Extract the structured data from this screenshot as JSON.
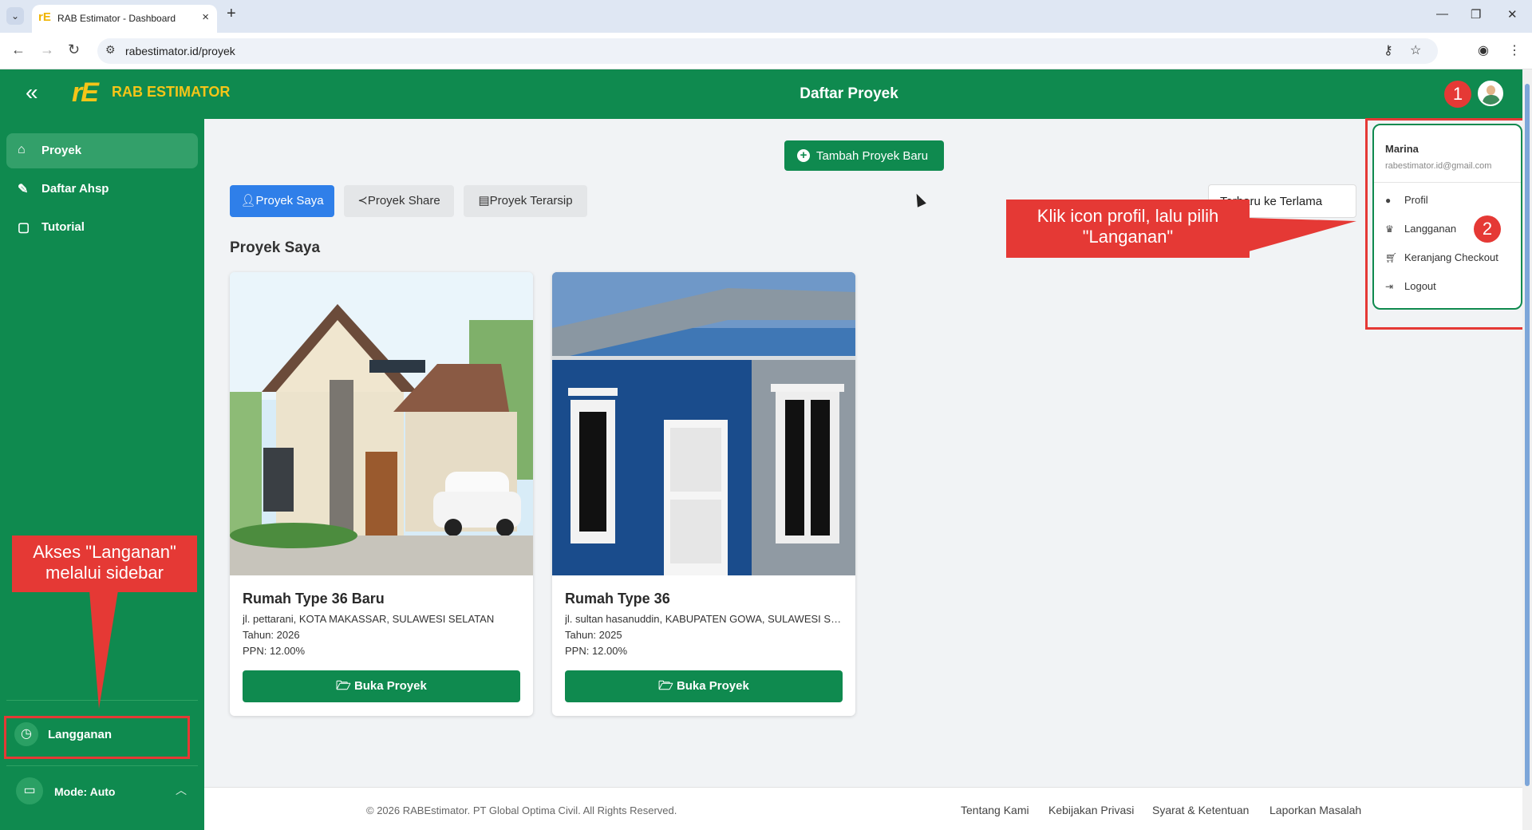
{
  "browser": {
    "tab_title": "RAB Estimator - Dashboard",
    "url": "rabestimator.id/proyek"
  },
  "header": {
    "logo_mark": "rE",
    "logo_text": "RAB ESTIMATOR",
    "title": "Daftar Proyek"
  },
  "sidebar": {
    "items": [
      {
        "label": "Proyek"
      },
      {
        "label": "Daftar Ahsp"
      },
      {
        "label": "Tutorial"
      }
    ],
    "langganan_label": "Langganan",
    "mode_label": "Mode: Auto"
  },
  "main": {
    "add_button": "Tambah Proyek Baru",
    "tabs": [
      {
        "label": "Proyek Saya"
      },
      {
        "label": "Proyek Share"
      },
      {
        "label": "Proyek Terarsip"
      }
    ],
    "sort_value": "Terbaru ke Terlama",
    "section_title": "Proyek Saya",
    "projects": [
      {
        "title": "Rumah Type 36 Baru",
        "address": "jl. pettarani, KOTA MAKASSAR, SULAWESI SELATAN",
        "year": "Tahun: 2026",
        "ppn": "PPN: 12.00%",
        "button": "Buka Proyek"
      },
      {
        "title": "Rumah Type 36",
        "address": "jl. sultan hasanuddin, KABUPATEN GOWA, SULAWESI SELATAN",
        "year": "Tahun: 2025",
        "ppn": "PPN: 12.00%",
        "button": "Buka Proyek"
      }
    ]
  },
  "dropdown": {
    "name": "Marina",
    "email": "rabestimator.id@gmail.com",
    "items": [
      {
        "label": "Profil"
      },
      {
        "label": "Langganan"
      },
      {
        "label": "Keranjang Checkout"
      },
      {
        "label": "Logout"
      }
    ]
  },
  "annotations": {
    "badge_1": "1",
    "badge_2": "2",
    "callout_profile": "Klik icon profil, lalu pilih \"Langanan\"",
    "callout_sidebar": "Akses \"Langanan\" melalui sidebar"
  },
  "footer": {
    "copyright": "© 2026 RABEstimator. PT Global Optima Civil. All Rights Reserved.",
    "links": [
      {
        "label": "Tentang Kami"
      },
      {
        "label": "Kebijakan Privasi"
      },
      {
        "label": "Syarat & Ketentuan"
      },
      {
        "label": "Laporkan Masalah"
      }
    ]
  },
  "colors": {
    "brand_green": "#0f8a4f",
    "accent_yellow": "#f5c518",
    "primary_blue": "#2f7fe9",
    "annotation_red": "#e53935"
  }
}
